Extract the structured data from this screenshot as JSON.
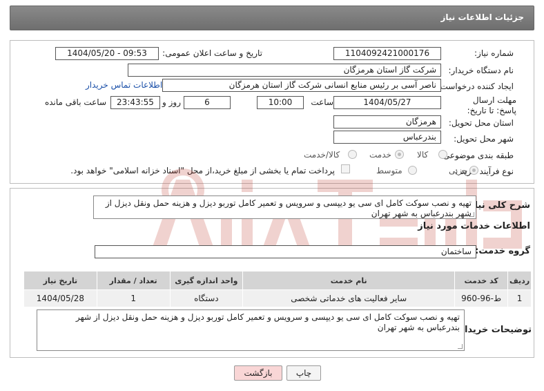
{
  "page_title": "جزئیات اطلاعات نیاز",
  "fields": {
    "need_number": {
      "label": "شماره نیاز:",
      "value": "1104092421000176"
    },
    "announce_datetime": {
      "label": "تاریخ و ساعت اعلان عمومی:",
      "value": "1404/05/20 - 09:53"
    },
    "buyer_org": {
      "label": "نام دستگاه خریدار:",
      "value": "شرکت گاز استان هرمزگان"
    },
    "request_creator": {
      "label": "ایجاد کننده درخواست:",
      "value": "ناصر آسی بر رئیس منابع انسانی شرکت گاز استان هرمزگان",
      "contact_link": "اطلاعات تماس خریدار"
    },
    "deadline": {
      "label": "مهلت ارسال پاسخ: تا تاریخ:",
      "date": "1404/05/27",
      "time_label": "ساعت",
      "time": "10:00",
      "days": "6",
      "days_label": "روز و",
      "remaining": "23:43:55",
      "remaining_label": "ساعت باقی مانده"
    },
    "delivery_province": {
      "label": "استان محل تحویل:",
      "value": "هرمزگان"
    },
    "delivery_city": {
      "label": "شهر محل تحویل:",
      "value": "بندرعباس"
    },
    "category": {
      "label": "طبقه بندی موضوعی:",
      "options": [
        "کالا",
        "خدمت",
        "کالا/خدمت"
      ],
      "selected": "خدمت"
    },
    "purchase_type": {
      "label": "نوع فرآیند خرید :",
      "options": [
        "جزیی",
        "متوسط"
      ],
      "selected": "جزیی",
      "treasury_note": "پرداخت تمام یا بخشی از مبلغ خرید،از محل \"اسناد خزانه اسلامی\" خواهد بود."
    }
  },
  "need_description": {
    "label": "شرح کلی نیاز:",
    "value": "تهیه و نصب سوکت کامل ای سی یو دیپسی و سرویس و تعمیر کامل توربو دیزل و هزینه حمل ونقل دیزل از شهر بندرعباس به شهر تهران"
  },
  "services_section": {
    "title": "اطلاعات خدمات مورد نیاز",
    "group_label": "گروه خدمت:",
    "group_value": "ساختمان",
    "table": {
      "headers": [
        "ردیف",
        "کد خدمت",
        "نام خدمت",
        "واحد اندازه گیری",
        "تعداد / مقدار",
        "تاریخ نیاز"
      ],
      "rows": [
        [
          "1",
          "ط-96-960",
          "سایر فعالیت های خدماتی شخصی",
          "دستگاه",
          "1",
          "1404/05/28"
        ]
      ]
    }
  },
  "buyer_notes": {
    "label": "توضیحات خریدار:",
    "value": "تهیه و نصب سوکت کامل ای سی یو دیپسی و سرویس و تعمیر کامل توربو دیزل و هزینه حمل ونقل دیزل از شهر بندرعباس به شهر تهران"
  },
  "buttons": {
    "print": "چاپ",
    "back": "بازگشت"
  },
  "colors": {
    "header": "#7a7a7a",
    "link": "#1a4fa8",
    "back_button": "#f9d6d6",
    "watermark": "#c0392b"
  }
}
